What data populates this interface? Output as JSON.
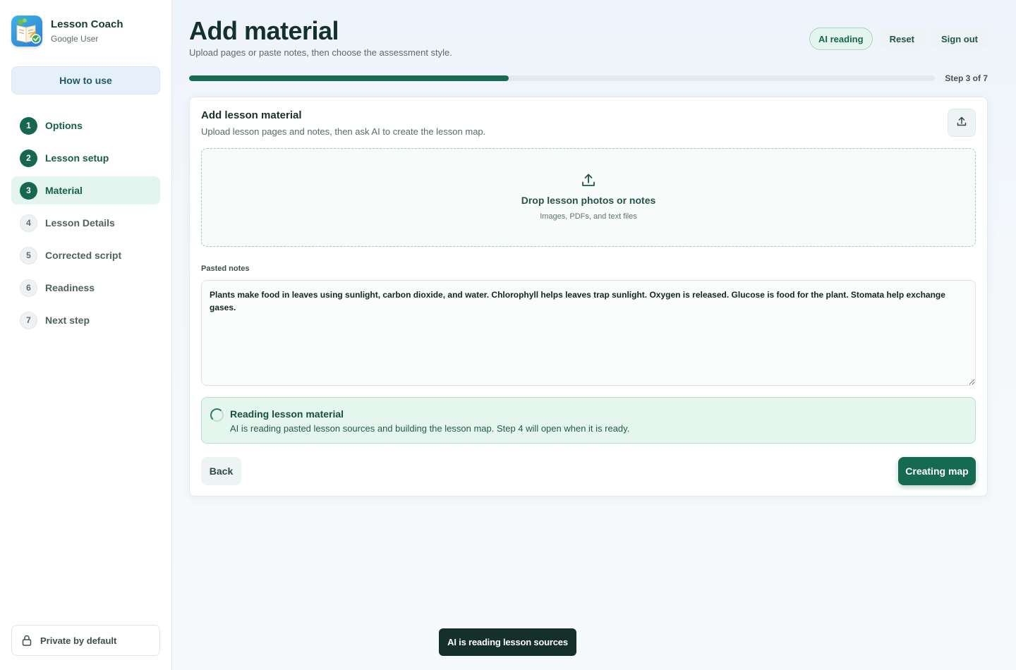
{
  "app": {
    "name": "Lesson Coach",
    "user": "Google User",
    "how_to_label": "How to use",
    "privacy_label": "Private by default"
  },
  "steps": [
    {
      "num": "1",
      "label": "Options",
      "state": "done"
    },
    {
      "num": "2",
      "label": "Lesson setup",
      "state": "done"
    },
    {
      "num": "3",
      "label": "Material",
      "state": "active"
    },
    {
      "num": "4",
      "label": "Lesson Details",
      "state": "todo"
    },
    {
      "num": "5",
      "label": "Corrected script",
      "state": "todo"
    },
    {
      "num": "6",
      "label": "Readiness",
      "state": "todo"
    },
    {
      "num": "7",
      "label": "Next step",
      "state": "todo"
    }
  ],
  "header": {
    "title": "Add material",
    "subtitle": "Upload pages or paste notes, then choose the assessment style.",
    "ai_badge": "AI reading",
    "reset_label": "Reset",
    "signout_label": "Sign out"
  },
  "progress": {
    "label": "Step 3 of 7",
    "fraction": 0.4286
  },
  "card": {
    "title": "Add lesson material",
    "subtitle": "Upload lesson pages and notes, then ask AI to create the lesson map.",
    "upload_icon": "upload-icon",
    "dropzone": {
      "title": "Drop lesson photos or notes",
      "subtitle": "Images, PDFs, and text files"
    },
    "notes_label": "Pasted notes",
    "notes_value": "Plants make food in leaves using sunlight, carbon dioxide, and water. Chlorophyll helps leaves trap sunlight. Oxygen is released. Glucose is food for the plant. Stomata help exchange gases.",
    "status": {
      "title": "Reading lesson material",
      "text": "AI is reading pasted lesson sources and building the lesson map. Step 4 will open when it is ready."
    },
    "back_label": "Back",
    "primary_label": "Creating map"
  },
  "toast": {
    "text": "AI is reading lesson sources"
  },
  "colors": {
    "accent": "#176a52",
    "active_step_bg": "#e4f4ee",
    "status_bg": "#e5f6ef",
    "toast_bg": "#15302b"
  }
}
